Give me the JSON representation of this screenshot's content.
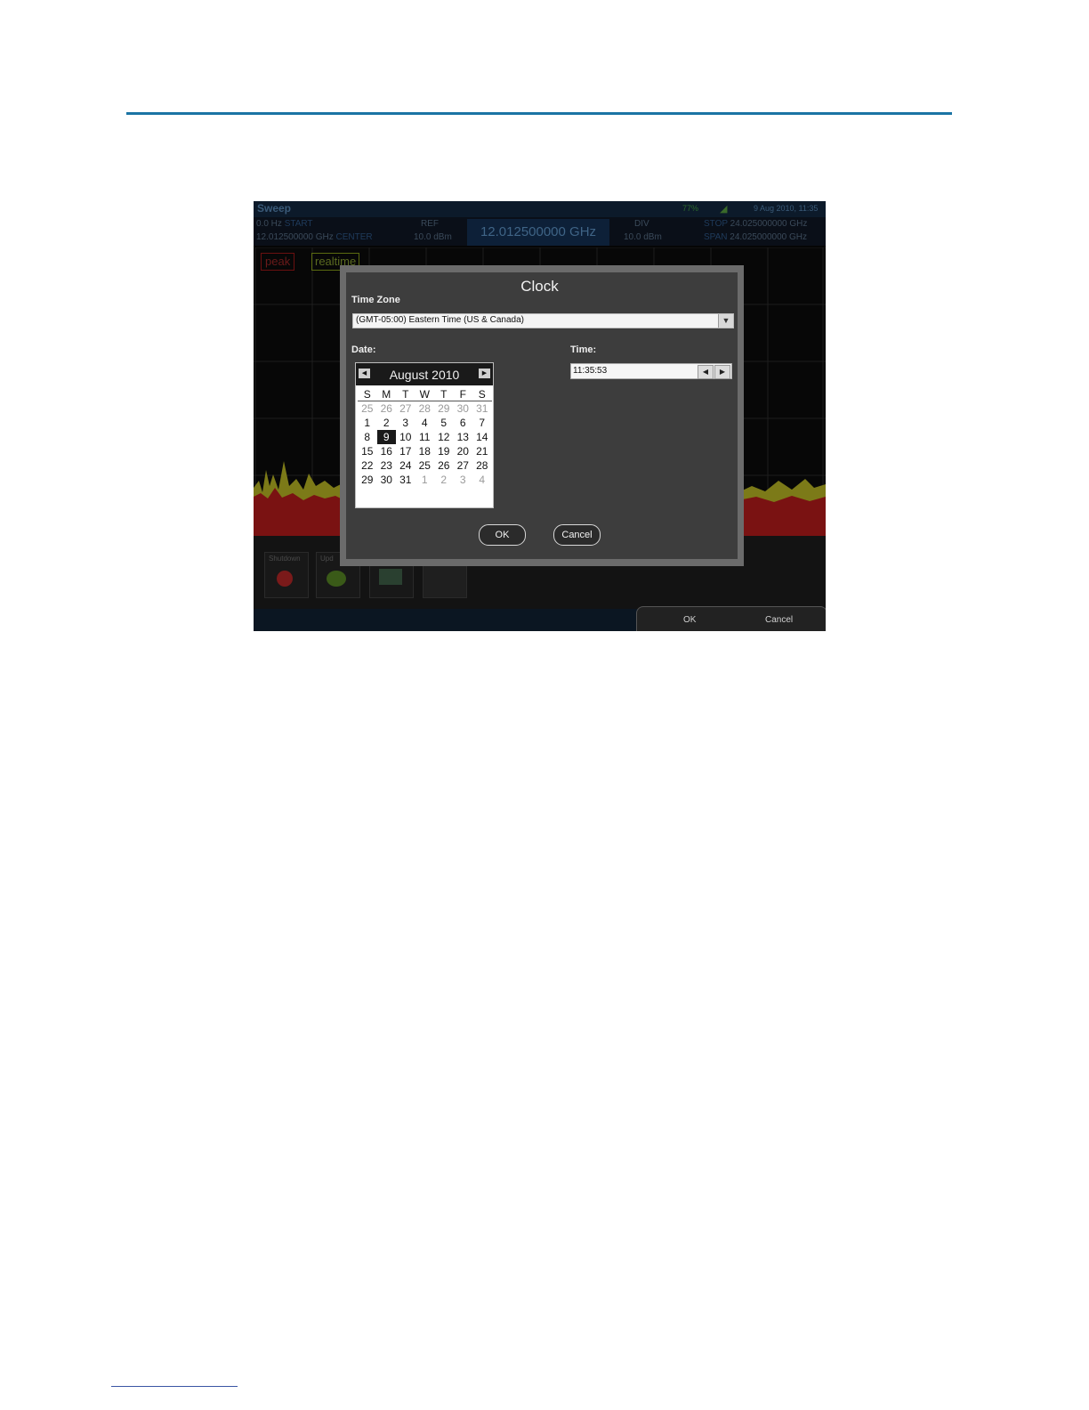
{
  "screen": {
    "title": "Sweep",
    "battery": "77%",
    "datetime": "9 Aug 2010, 11:35",
    "start_value": "0.0 Hz",
    "start_label": "START",
    "center_value": "12.012500000 GHz",
    "center_label": "CENTER",
    "ref_label": "REF",
    "ref_value": "10.0 dBm",
    "center_freq_display": "12.012500000 GHz",
    "div_label": "DIV",
    "div_value": "10.0 dBm",
    "stop_label": "STOP",
    "stop_value": "24.025000000 GHz",
    "span_label": "SPAN",
    "span_value": "24.025000000 GHz",
    "tag_peak": "peak",
    "tag_realtime": "realtime",
    "tile_shutdown": "Shutdown",
    "tile_update": "Upd",
    "ok_label": "OK",
    "cancel_label": "Cancel"
  },
  "dialog": {
    "title": "Clock",
    "timezone_label": "Time Zone",
    "timezone_value": "(GMT-05:00) Eastern Time (US & Canada)",
    "date_label": "Date:",
    "time_label": "Time:",
    "time_value": "11:35:53",
    "ok_label": "OK",
    "cancel_label": "Cancel"
  },
  "calendar": {
    "month": "August 2010",
    "weekdays": [
      "S",
      "M",
      "T",
      "W",
      "T",
      "F",
      "S"
    ],
    "weeks": [
      [
        "25",
        "26",
        "27",
        "28",
        "29",
        "30",
        "31"
      ],
      [
        "1",
        "2",
        "3",
        "4",
        "5",
        "6",
        "7"
      ],
      [
        "8",
        "9",
        "10",
        "11",
        "12",
        "13",
        "14"
      ],
      [
        "15",
        "16",
        "17",
        "18",
        "19",
        "20",
        "21"
      ],
      [
        "22",
        "23",
        "24",
        "25",
        "26",
        "27",
        "28"
      ],
      [
        "29",
        "30",
        "31",
        "1",
        "2",
        "3",
        "4"
      ]
    ],
    "selected": "9"
  },
  "colors": {
    "accent_rule": "#1b74a4",
    "trace_red": "#b01818",
    "trace_yellow": "#a8a020"
  }
}
